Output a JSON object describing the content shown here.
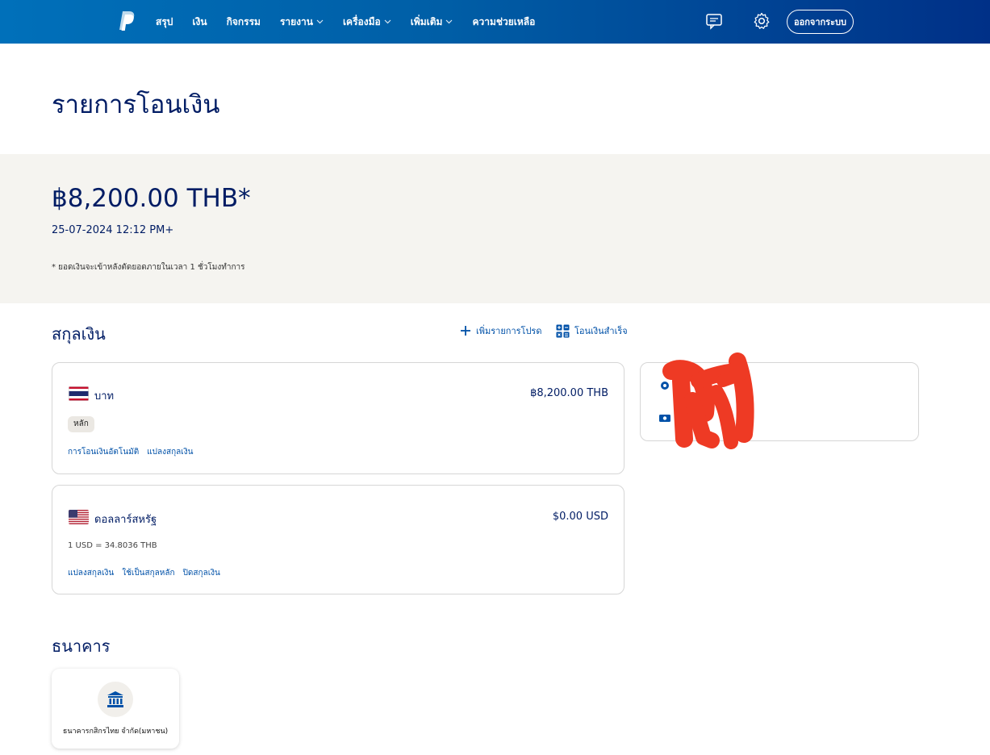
{
  "nav": {
    "items": [
      {
        "label": "สรุป",
        "has_dropdown": false
      },
      {
        "label": "เงิน",
        "has_dropdown": false
      },
      {
        "label": "กิจกรรม",
        "has_dropdown": false
      },
      {
        "label": "รายงาน",
        "has_dropdown": true
      },
      {
        "label": "เครื่องมือ",
        "has_dropdown": true
      },
      {
        "label": "เพิ่มเติม",
        "has_dropdown": true
      },
      {
        "label": "ความช่วยเหลือ",
        "has_dropdown": false
      }
    ],
    "logout_label": "ออกจากระบบ",
    "icons": [
      "paypal-logo",
      "message-center-icon",
      "settings-gear-icon"
    ]
  },
  "page": {
    "title": "รายการโอนเงิน"
  },
  "balance": {
    "amount": "฿8,200.00 THB*",
    "datetime": "25-07-2024 12:12 PM+",
    "note": "* ยอดเงินจะเข้าหลังตัดยอดภายในเวลา 1 ชั่วโมงทำการ"
  },
  "currencies": {
    "section_title": "สกุลเงิน",
    "add_link_label": "เพิ่มรายการโปรด",
    "transfer_link_label": "โอนเงินสำเร็จ",
    "items": [
      {
        "name": "บาท",
        "amount": "฿8,200.00 THB",
        "flag": "thailand-flag",
        "badge": "หลัก",
        "links": [
          "การโอนเงินอัตโนมัติ",
          "แปลงสกุลเงิน"
        ]
      },
      {
        "name": "ดอลลาร์สหรัฐ",
        "amount": "$0.00 USD",
        "flag": "usa-flag",
        "rate": "1 USD = 34.8036 THB",
        "links": [
          "แปลงสกุลเงิน",
          "ใช้เป็นสกุลหลัก",
          "ปิดสกุลเงิน"
        ]
      }
    ]
  },
  "bank": {
    "section_title": "ธนาคาร",
    "name": "ธนาคารกสิกรไทย จำกัด(มหาชน)"
  },
  "colors": {
    "nav_gradient_start": "#0070ba",
    "nav_gradient_end": "#003087",
    "text_primary": "#001c64",
    "link": "#0051a8",
    "band_bg": "#f5f4f0",
    "scribble": "#ee3a24"
  }
}
